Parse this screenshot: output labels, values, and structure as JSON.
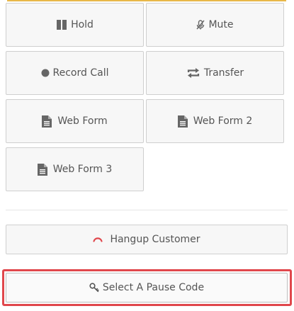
{
  "buttons": {
    "hold": {
      "label": "Hold",
      "icon": "pause-icon"
    },
    "mute": {
      "label": "Mute",
      "icon": "microphone-slash-icon"
    },
    "record": {
      "label": "Record Call",
      "icon": "record-dot-icon"
    },
    "transfer": {
      "label": "Transfer",
      "icon": "transfer-arrows-icon"
    },
    "web_form": {
      "label": "Web Form",
      "icon": "document-icon"
    },
    "web_form_2": {
      "label": "Web Form 2",
      "icon": "document-icon"
    },
    "web_form_3": {
      "label": "Web Form 3",
      "icon": "document-icon"
    },
    "hangup": {
      "label": "Hangup Customer",
      "icon": "phone-hangup-icon"
    },
    "pause_code": {
      "label": "Select A Pause Code",
      "icon": "key-icon"
    }
  },
  "colors": {
    "accent_top_line": "#e8b84a",
    "hangup_icon": "#e0474c",
    "highlight_border": "#e0474c",
    "button_bg": "#f7f7f7",
    "button_border": "#cfcfcf",
    "text": "#555555"
  }
}
